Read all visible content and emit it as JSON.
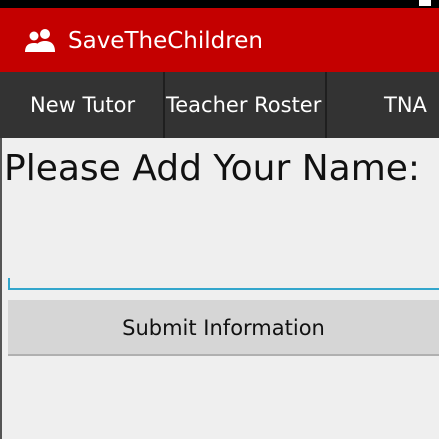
{
  "app": {
    "title": "SaveTheChildren",
    "icon": "people-icon"
  },
  "tabs": [
    {
      "label": "New Tutor"
    },
    {
      "label": "Teacher Roster"
    },
    {
      "label": "TNA"
    }
  ],
  "form": {
    "prompt": "Please Add Your Name:",
    "name_value": "",
    "submit_label": "Submit Information"
  },
  "colors": {
    "action_bar": "#c40000",
    "tab_bar": "#333333",
    "input_underline": "#33a6cc",
    "button": "#d6d6d6"
  }
}
